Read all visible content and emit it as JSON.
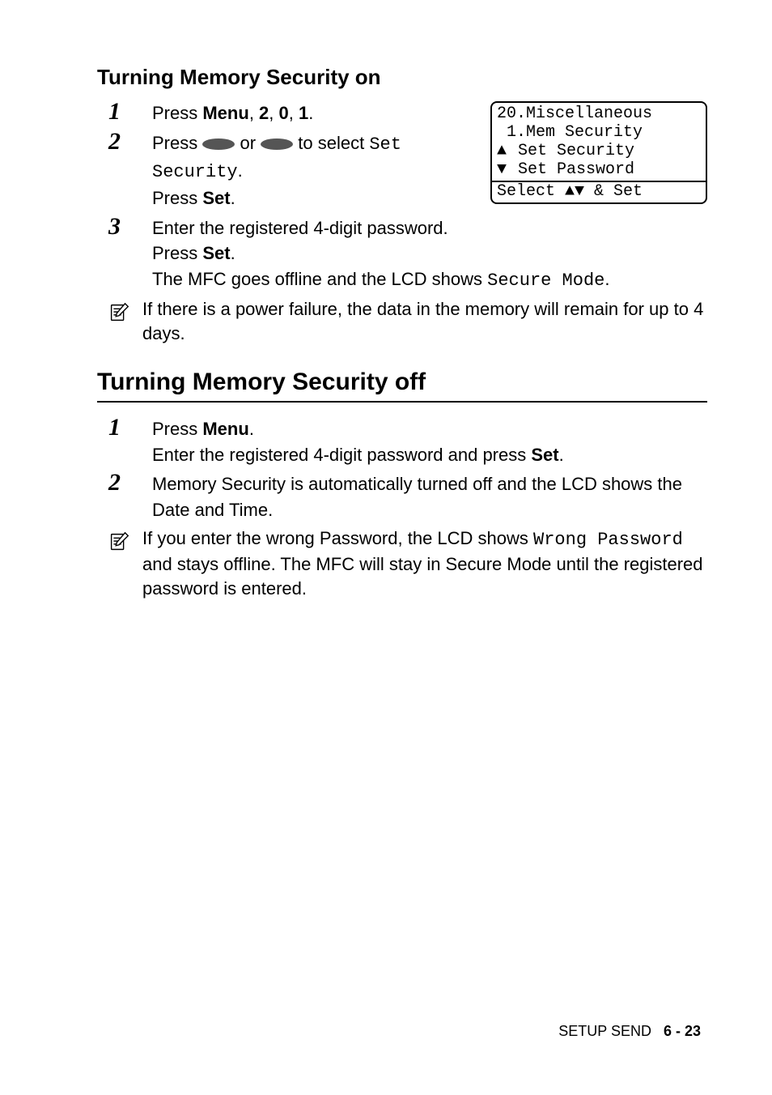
{
  "section1": {
    "title": "Turning Memory Security on",
    "steps": [
      {
        "num": "1",
        "text_1": "Press ",
        "menu": "Menu",
        "text_2": ", ",
        "d1": "2",
        "text_3": ", ",
        "d2": "0",
        "text_4": ", ",
        "d3": "1",
        "text_5": "."
      },
      {
        "num": "2",
        "text_1": "Press ",
        "text_or": " or ",
        "text_2": " to select ",
        "code": "Set Security",
        "text_3": ".",
        "line2a": "Press ",
        "line2b": "Set",
        "line2c": "."
      },
      {
        "num": "3",
        "l1": "Enter the registered 4-digit password.",
        "l2a": "Press ",
        "l2b": "Set",
        "l2c": ".",
        "l3a": "The MFC goes offline and the LCD shows ",
        "l3b": "Secure Mode",
        "l3c": "."
      }
    ],
    "lcd": {
      "l1": "20.Miscellaneous",
      "l2": " 1.Mem Security",
      "l3_arrow": "▲",
      "l3_txt": "   Set Security",
      "l4_arrow": "▼",
      "l4_txt": "   Set Password",
      "l5": "Select ▲▼ & Set"
    },
    "note": "If there is a power failure, the data in the memory will remain for up to 4 days."
  },
  "section2": {
    "title": "Turning Memory Security off",
    "steps": [
      {
        "num": "1",
        "l1a": "Press ",
        "l1b": "Menu",
        "l1c": ".",
        "l2a": "Enter the registered 4-digit password and press ",
        "l2b": "Set",
        "l2c": "."
      },
      {
        "num": "2",
        "l1": "Memory Security is automatically turned off and the LCD shows the Date and Time."
      }
    ],
    "note_a": "If you enter the wrong Password, the LCD shows ",
    "note_code": "Wrong Password",
    "note_b": " and stays offline. The MFC will stay in Secure Mode until the registered password is entered."
  },
  "footer": {
    "section": "SETUP SEND",
    "page": "6 - 23"
  }
}
